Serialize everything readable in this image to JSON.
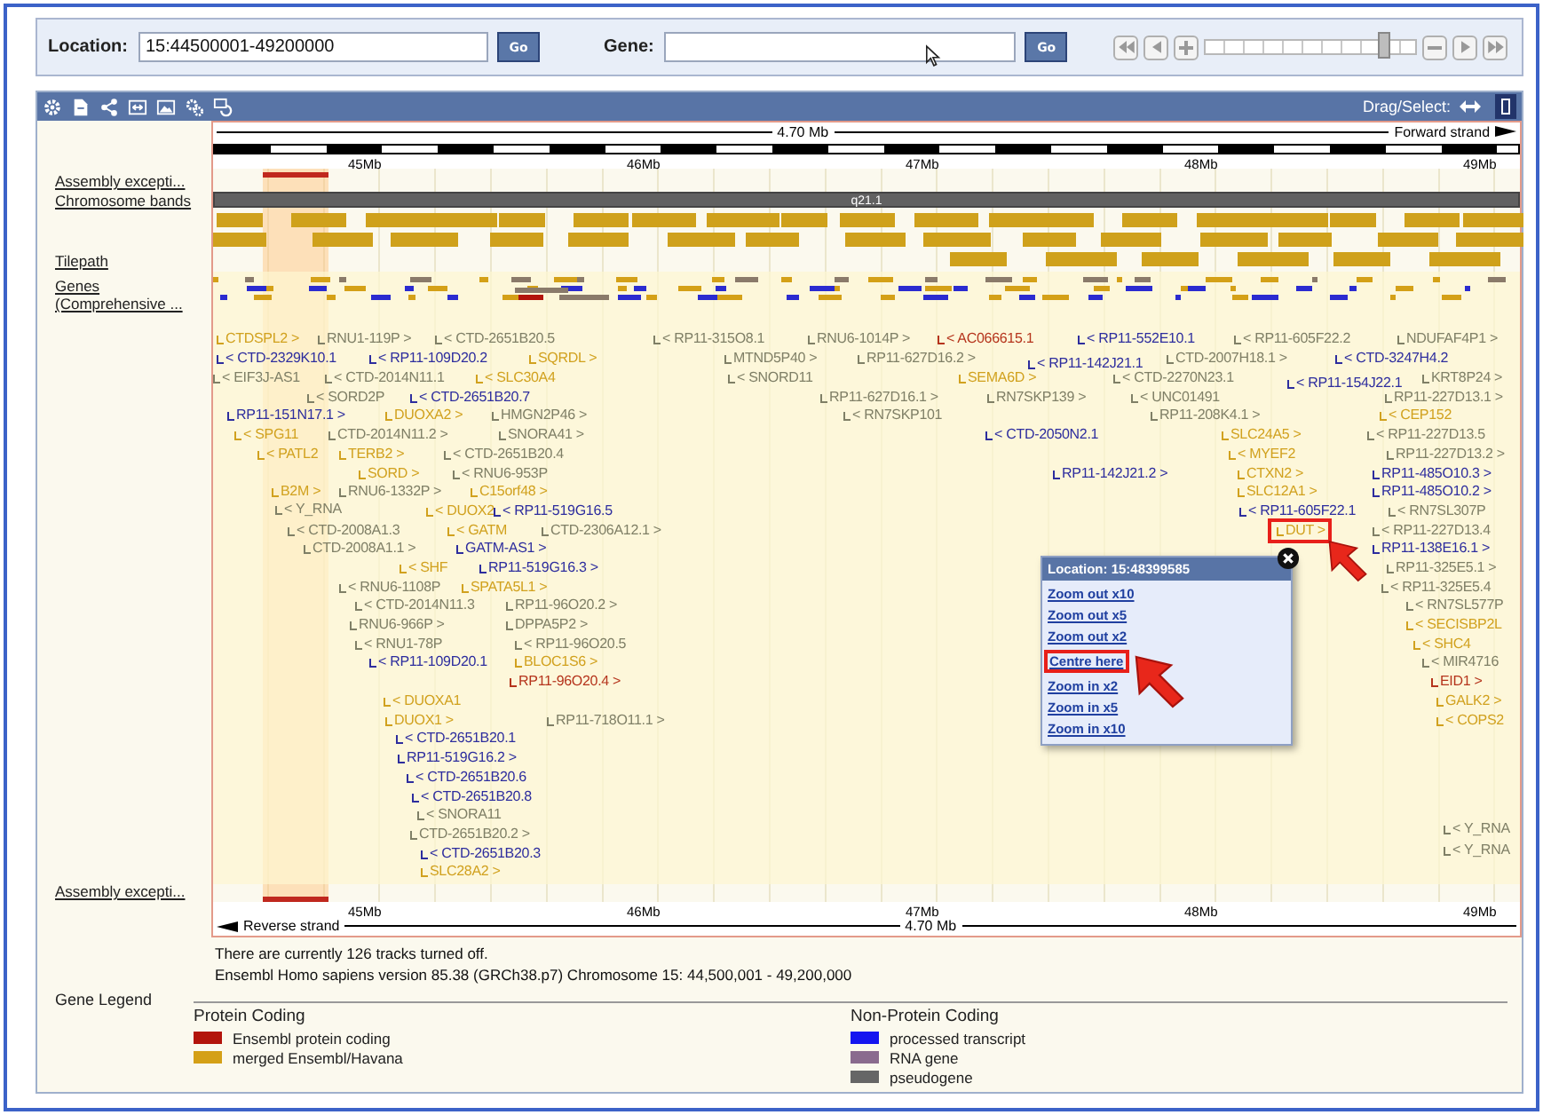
{
  "search_bar": {
    "location": {
      "label": "Location:",
      "value": "15:44500001-49200000",
      "button": "Go"
    },
    "gene": {
      "label": "Gene:",
      "button": "Go"
    },
    "zoom_slider": {
      "level": 0.86
    }
  },
  "toolbar": {
    "drag_select_label": "Drag/Select:"
  },
  "browser": {
    "top_ruler": {
      "length": "4.70 Mb",
      "strand": "Forward strand",
      "ticks": [
        "45Mb",
        "46Mb",
        "47Mb",
        "48Mb",
        "49Mb"
      ]
    },
    "tracks": {
      "assembly_top": "Assembly excepti...",
      "chromosome_bands": {
        "label": "Chromosome bands",
        "band": "q21.1"
      },
      "tilepath": "Tilepath",
      "genes": {
        "label": "Genes",
        "sublabel": "(Comprehensive ..."
      },
      "assembly_bottom": "Assembly excepti..."
    },
    "genes": [
      {
        "name": "CTDSPL2 >",
        "color": "#d1a11e",
        "boxed": false
      },
      {
        "name": "RNU1-119P >",
        "color": "#7f7f66",
        "boxed": false
      },
      {
        "name": "< CTD-2651B20.5",
        "color": "#7f7f66",
        "boxed": false
      },
      {
        "name": "< RP11-315O8.1",
        "color": "#7f7f66",
        "boxed": false
      },
      {
        "name": "RNU6-1014P >",
        "color": "#7f7f66",
        "boxed": false
      },
      {
        "name": "< AC066615.1",
        "color": "#b5341c",
        "boxed": false
      },
      {
        "name": "< RP11-552E10.1",
        "color": "#2d2d9e",
        "boxed": false
      },
      {
        "name": "< RP11-605F22.2",
        "color": "#7f7f66",
        "boxed": false
      },
      {
        "name": "NDUFAF4P1 >",
        "color": "#7f7f66",
        "boxed": false
      },
      {
        "name": "< CTD-2329K10.1",
        "color": "#2d2d9e",
        "boxed": false
      },
      {
        "name": "< RP11-109D20.2",
        "color": "#2d2d9e",
        "boxed": false
      },
      {
        "name": "SQRDL >",
        "color": "#d1a11e",
        "boxed": false
      },
      {
        "name": "MTND5P40 >",
        "color": "#7f7f66",
        "boxed": false
      },
      {
        "name": "RP11-627D16.2 >",
        "color": "#7f7f66",
        "boxed": false
      },
      {
        "name": "< RP11-142J21.1",
        "color": "#2d2d9e",
        "boxed": false
      },
      {
        "name": "CTD-2007H18.1 >",
        "color": "#7f7f66",
        "boxed": false
      },
      {
        "name": "< CTD-3247H4.2",
        "color": "#2d2d9e",
        "boxed": false
      },
      {
        "name": "< EIF3J-AS1",
        "color": "#7f7f66",
        "boxed": false
      },
      {
        "name": "< CTD-2014N11.1",
        "color": "#7f7f66",
        "boxed": false
      },
      {
        "name": "< SLC30A4",
        "color": "#d1a11e",
        "boxed": false
      },
      {
        "name": "< SNORD11",
        "color": "#7f7f66",
        "boxed": false
      },
      {
        "name": "SEMA6D >",
        "color": "#d1a11e",
        "boxed": false
      },
      {
        "name": "< CTD-2270N23.1",
        "color": "#7f7f66",
        "boxed": false
      },
      {
        "name": "< RP11-154J22.1",
        "color": "#2d2d9e",
        "boxed": false
      },
      {
        "name": "KRT8P24 >",
        "color": "#7f7f66",
        "boxed": false
      },
      {
        "name": "< SORD2P",
        "color": "#7f7f66",
        "boxed": false
      },
      {
        "name": "< CTD-2651B20.7",
        "color": "#2d2d9e",
        "boxed": false
      },
      {
        "name": "RP11-627D16.1 >",
        "color": "#7f7f66",
        "boxed": false
      },
      {
        "name": "RN7SKP139 >",
        "color": "#7f7f66",
        "boxed": false
      },
      {
        "name": "< UNC01491",
        "color": "#7f7f66",
        "boxed": false
      },
      {
        "name": "RP11-227D13.1 >",
        "color": "#7f7f66",
        "boxed": false
      },
      {
        "name": "RP11-151N17.1 >",
        "color": "#2d2d9e",
        "boxed": false
      },
      {
        "name": "DUOXA2 >",
        "color": "#d1a11e",
        "boxed": false
      },
      {
        "name": "HMGN2P46 >",
        "color": "#7f7f66",
        "boxed": false
      },
      {
        "name": "< RN7SKP101",
        "color": "#7f7f66",
        "boxed": false
      },
      {
        "name": "RP11-208K4.1 >",
        "color": "#7f7f66",
        "boxed": false
      },
      {
        "name": "< CEP152",
        "color": "#d1a11e",
        "boxed": false
      },
      {
        "name": "< SPG11",
        "color": "#d1a11e",
        "boxed": false
      },
      {
        "name": "CTD-2014N11.2 >",
        "color": "#7f7f66",
        "boxed": false
      },
      {
        "name": "SNORA41 >",
        "color": "#7f7f66",
        "boxed": false
      },
      {
        "name": "< CTD-2050N2.1",
        "color": "#2d2d9e",
        "boxed": false
      },
      {
        "name": "SLC24A5 >",
        "color": "#d1a11e",
        "boxed": false
      },
      {
        "name": "< RP11-227D13.5",
        "color": "#7f7f66",
        "boxed": false
      },
      {
        "name": "< PATL2",
        "color": "#d1a11e",
        "boxed": false
      },
      {
        "name": "TERB2 >",
        "color": "#d1a11e",
        "boxed": false
      },
      {
        "name": "< CTD-2651B20.4",
        "color": "#7f7f66",
        "boxed": false
      },
      {
        "name": "< MYEF2",
        "color": "#d1a11e",
        "boxed": false
      },
      {
        "name": "RP11-227D13.2 >",
        "color": "#7f7f66",
        "boxed": false
      },
      {
        "name": "SORD >",
        "color": "#d1a11e",
        "boxed": false
      },
      {
        "name": "< RNU6-953P",
        "color": "#7f7f66",
        "boxed": false
      },
      {
        "name": "RP11-142J21.2 >",
        "color": "#2d2d9e",
        "boxed": false
      },
      {
        "name": "CTXN2 >",
        "color": "#d1a11e",
        "boxed": false
      },
      {
        "name": "RP11-485O10.3 >",
        "color": "#2d2d9e",
        "boxed": false
      },
      {
        "name": "B2M >",
        "color": "#d1a11e",
        "boxed": false
      },
      {
        "name": "RNU6-1332P >",
        "color": "#7f7f66",
        "boxed": false
      },
      {
        "name": "C15orf48 >",
        "color": "#d1a11e",
        "boxed": false
      },
      {
        "name": "SLC12A1 >",
        "color": "#d1a11e",
        "boxed": false
      },
      {
        "name": "RP11-485O10.2 >",
        "color": "#2d2d9e",
        "boxed": false
      },
      {
        "name": "< Y_RNA",
        "color": "#7f7f66",
        "boxed": false
      },
      {
        "name": "< DUOX2",
        "color": "#d1a11e",
        "boxed": false
      },
      {
        "name": "< RP11-519G16.5",
        "color": "#2d2d9e",
        "boxed": false
      },
      {
        "name": "< RP11-605F22.1",
        "color": "#2d2d9e",
        "boxed": false
      },
      {
        "name": "< RN7SL307P",
        "color": "#7f7f66",
        "boxed": false
      },
      {
        "name": "< CTD-2008A1.3",
        "color": "#7f7f66",
        "boxed": false
      },
      {
        "name": "< GATM",
        "color": "#d1a11e",
        "boxed": false
      },
      {
        "name": "CTD-2306A12.1 >",
        "color": "#7f7f66",
        "boxed": false
      },
      {
        "name": "DUT >",
        "color": "#d1a11e",
        "boxed": true
      },
      {
        "name": "< RP11-227D13.4",
        "color": "#7f7f66",
        "boxed": false
      },
      {
        "name": "CTD-2008A1.1 >",
        "color": "#7f7f66",
        "boxed": false
      },
      {
        "name": "GATM-AS1 >",
        "color": "#2d2d9e",
        "boxed": false
      },
      {
        "name": "RP11-138E16.1 >",
        "color": "#2d2d9e",
        "boxed": false
      },
      {
        "name": "< SHF",
        "color": "#d1a11e",
        "boxed": false
      },
      {
        "name": "RP11-519G16.3 >",
        "color": "#2d2d9e",
        "boxed": false
      },
      {
        "name": "RP11-325E5.1 >",
        "color": "#7f7f66",
        "boxed": false
      },
      {
        "name": "< RNU6-1108P",
        "color": "#7f7f66",
        "boxed": false
      },
      {
        "name": "SPATA5L1 >",
        "color": "#d1a11e",
        "boxed": false
      },
      {
        "name": "< RP11-325E5.4",
        "color": "#7f7f66",
        "boxed": false
      },
      {
        "name": "< CTD-2014N11.3",
        "color": "#7f7f66",
        "boxed": false
      },
      {
        "name": "RP11-96O20.2 >",
        "color": "#7f7f66",
        "boxed": false
      },
      {
        "name": "< RN7SL577P",
        "color": "#7f7f66",
        "boxed": false
      },
      {
        "name": "RNU6-966P >",
        "color": "#7f7f66",
        "boxed": false
      },
      {
        "name": "DPPA5P2 >",
        "color": "#7f7f66",
        "boxed": false
      },
      {
        "name": "< SECISBP2L",
        "color": "#d1a11e",
        "boxed": false
      },
      {
        "name": "< RNU1-78P",
        "color": "#7f7f66",
        "boxed": false
      },
      {
        "name": "< RP11-96O20.5",
        "color": "#7f7f66",
        "boxed": false
      },
      {
        "name": "< SHC4",
        "color": "#d1a11e",
        "boxed": false
      },
      {
        "name": "< RP11-109D20.1",
        "color": "#2d2d9e",
        "boxed": false
      },
      {
        "name": "BLOC1S6 >",
        "color": "#d1a11e",
        "boxed": false
      },
      {
        "name": "< MIR4716",
        "color": "#7f7f66",
        "boxed": false
      },
      {
        "name": "RP11-96O20.4 >",
        "color": "#b5341c",
        "boxed": false
      },
      {
        "name": "EID1 >",
        "color": "#b5341c",
        "boxed": false
      },
      {
        "name": "< DUOXA1",
        "color": "#d1a11e",
        "boxed": false
      },
      {
        "name": "GALK2 >",
        "color": "#d1a11e",
        "boxed": false
      },
      {
        "name": "DUOX1 >",
        "color": "#d1a11e",
        "boxed": false
      },
      {
        "name": "RP11-718O11.1 >",
        "color": "#7f7f66",
        "boxed": false
      },
      {
        "name": "< COPS2",
        "color": "#d1a11e",
        "boxed": false
      },
      {
        "name": "< CTD-2651B20.1",
        "color": "#2d2d9e",
        "boxed": false
      },
      {
        "name": "RP11-519G16.2 >",
        "color": "#2d2d9e",
        "boxed": false
      },
      {
        "name": "< CTD-2651B20.6",
        "color": "#2d2d9e",
        "boxed": false
      },
      {
        "name": "< CTD-2651B20.8",
        "color": "#2d2d9e",
        "boxed": false
      },
      {
        "name": "< SNORA11",
        "color": "#7f7f66",
        "boxed": false
      },
      {
        "name": "< Y_RNA",
        "color": "#7f7f66",
        "boxed": false
      },
      {
        "name": "CTD-2651B20.2 >",
        "color": "#7f7f66",
        "boxed": false
      },
      {
        "name": "< Y_RNA",
        "color": "#7f7f66",
        "boxed": false
      },
      {
        "name": "< CTD-2651B20.3",
        "color": "#2d2d9e",
        "boxed": false
      },
      {
        "name": "SLC28A2 >",
        "color": "#d1a11e",
        "boxed": false
      }
    ],
    "popup": {
      "title": "Location: 15:48399585",
      "links": [
        {
          "label": "Zoom out x10",
          "selected": false
        },
        {
          "label": "Zoom out x5",
          "selected": false
        },
        {
          "label": "Zoom out x2",
          "selected": false
        },
        {
          "label": "Centre here",
          "selected": true
        },
        {
          "label": "Zoom in x2",
          "selected": false
        },
        {
          "label": "Zoom in x5",
          "selected": false
        },
        {
          "label": "Zoom in x10",
          "selected": false
        }
      ]
    },
    "bottom_ruler": {
      "length": "4.70 Mb",
      "strand": "Reverse strand",
      "ticks": [
        "45Mb",
        "46Mb",
        "47Mb",
        "48Mb",
        "49Mb"
      ]
    }
  },
  "info": [
    "There are currently 126 tracks turned off.",
    "Ensembl Homo sapiens version 85.38 (GRCh38.p7) Chromosome 15: 44,500,001 - 49,200,000"
  ],
  "legend": {
    "title": "Gene Legend",
    "groups": [
      {
        "title": "Protein Coding",
        "items": [
          {
            "label": "Ensembl protein coding",
            "color": "#b3140c"
          },
          {
            "label": "merged Ensembl/Havana",
            "color": "#d4a017"
          }
        ]
      },
      {
        "title": "Non-Protein Coding",
        "items": [
          {
            "label": "processed transcript",
            "color": "#1515f0"
          },
          {
            "label": "RNA gene",
            "color": "#8a6b8e"
          },
          {
            "label": "pseudogene",
            "color": "#666666"
          }
        ]
      }
    ]
  }
}
